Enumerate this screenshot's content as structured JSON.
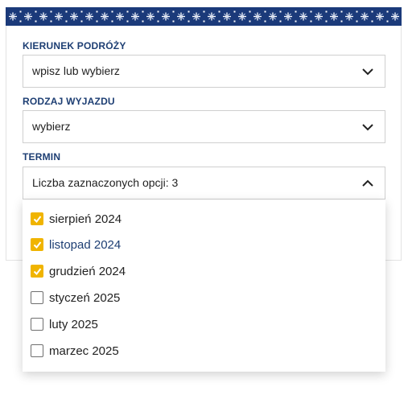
{
  "form": {
    "destination": {
      "label": "KIERUNEK PODRÓŻY",
      "value": "wpisz lub wybierz"
    },
    "trip_type": {
      "label": "RODZAJ WYJAZDU",
      "value": "wybierz"
    },
    "term": {
      "label": "TERMIN",
      "value": "Liczba zaznaczonych opcji: 3"
    }
  },
  "term_options": [
    {
      "label": "sierpień 2024",
      "checked": true
    },
    {
      "label": "listopad 2024",
      "checked": true
    },
    {
      "label": "grudzień 2024",
      "checked": true
    },
    {
      "label": "styczeń 2025",
      "checked": false
    },
    {
      "label": "luty 2025",
      "checked": false
    },
    {
      "label": "marzec 2025",
      "checked": false
    }
  ],
  "colors": {
    "pattern_bg": "#1b3a7a",
    "label": "#1d3e73",
    "checkbox_checked": "#f0b400"
  },
  "icons": {
    "dropdown_closed": "chevron-down-icon",
    "dropdown_open": "chevron-up-icon",
    "check": "check-icon",
    "pattern": "snowflake-pattern"
  }
}
